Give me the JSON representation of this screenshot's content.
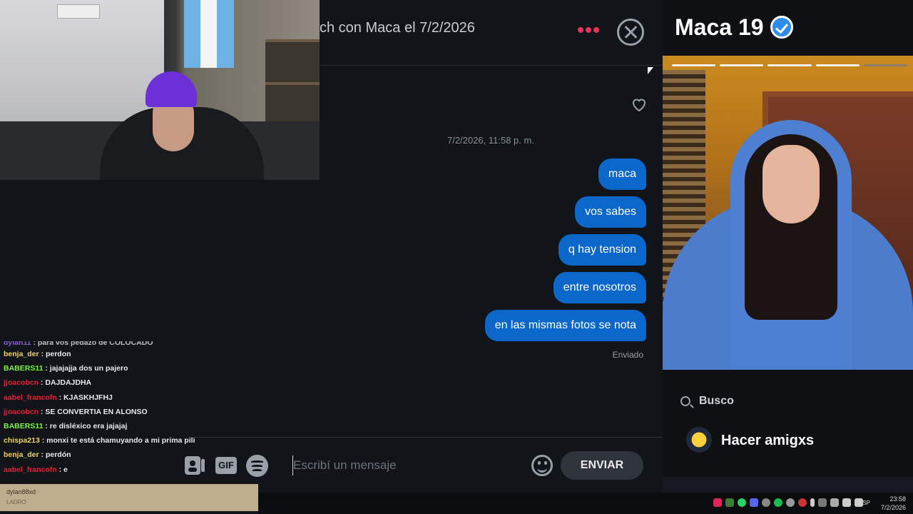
{
  "chat": {
    "header_title": "ch con Maca el 7/2/2026",
    "timestamp": "7/2/2026, 11:58 p. m.",
    "messages": [
      "maca",
      "vos sabes",
      "q hay tension",
      "entre nosotros",
      "en las mismas fotos se nota"
    ],
    "sent_status": "Enviado",
    "input_placeholder": "Escribí un mensaje",
    "send_label": "ENVIAR",
    "gif_label": "GIF"
  },
  "profile": {
    "name": "Maca 19",
    "busco_label": "Busco",
    "looking_for": "Hacer amigxs",
    "photo_progress": {
      "total": 5,
      "active": 4
    }
  },
  "twitch_chat": {
    "lines": [
      {
        "user": "dylan11",
        "color": "#a970ff",
        "text": "para vos pedazo de COLOCADO"
      },
      {
        "user": "benja_der",
        "color": "#f0d26a",
        "text": "perdon"
      },
      {
        "user": "BABERS11",
        "color": "#7cf542",
        "text": "jajajajja dos un pajero"
      },
      {
        "user": "jjoacobcn",
        "color": "#e0233a",
        "text": "DAJDAJDHA"
      },
      {
        "user": "aabel_francofn",
        "color": "#e0233a",
        "text": "KJASKHJFHJ"
      },
      {
        "user": "jjoacobcn",
        "color": "#e0233a",
        "text": "SE CONVERTIA EN ALONSO"
      },
      {
        "user": "BABERS11",
        "color": "#7cf542",
        "text": "re disléxico era jajajaj"
      },
      {
        "user": "chispa213",
        "color": "#f0d26a",
        "text": "monxi te está chamuyando a mi prima pili"
      },
      {
        "user": "benja_der",
        "color": "#f0d26a",
        "text": "perdón"
      },
      {
        "user": "aabel_francofn",
        "color": "#e0233a",
        "text": "e"
      }
    ]
  },
  "viewer_popup": {
    "user": "dylan88xd",
    "sub": "LADRO"
  },
  "taskbar": {
    "lang": "ESP",
    "time": "23:58",
    "date": "7/2/2026"
  },
  "colors": {
    "bubble": "#0b67c9",
    "accent_dots": "#e8325a",
    "verified": "#2d8cf0"
  }
}
